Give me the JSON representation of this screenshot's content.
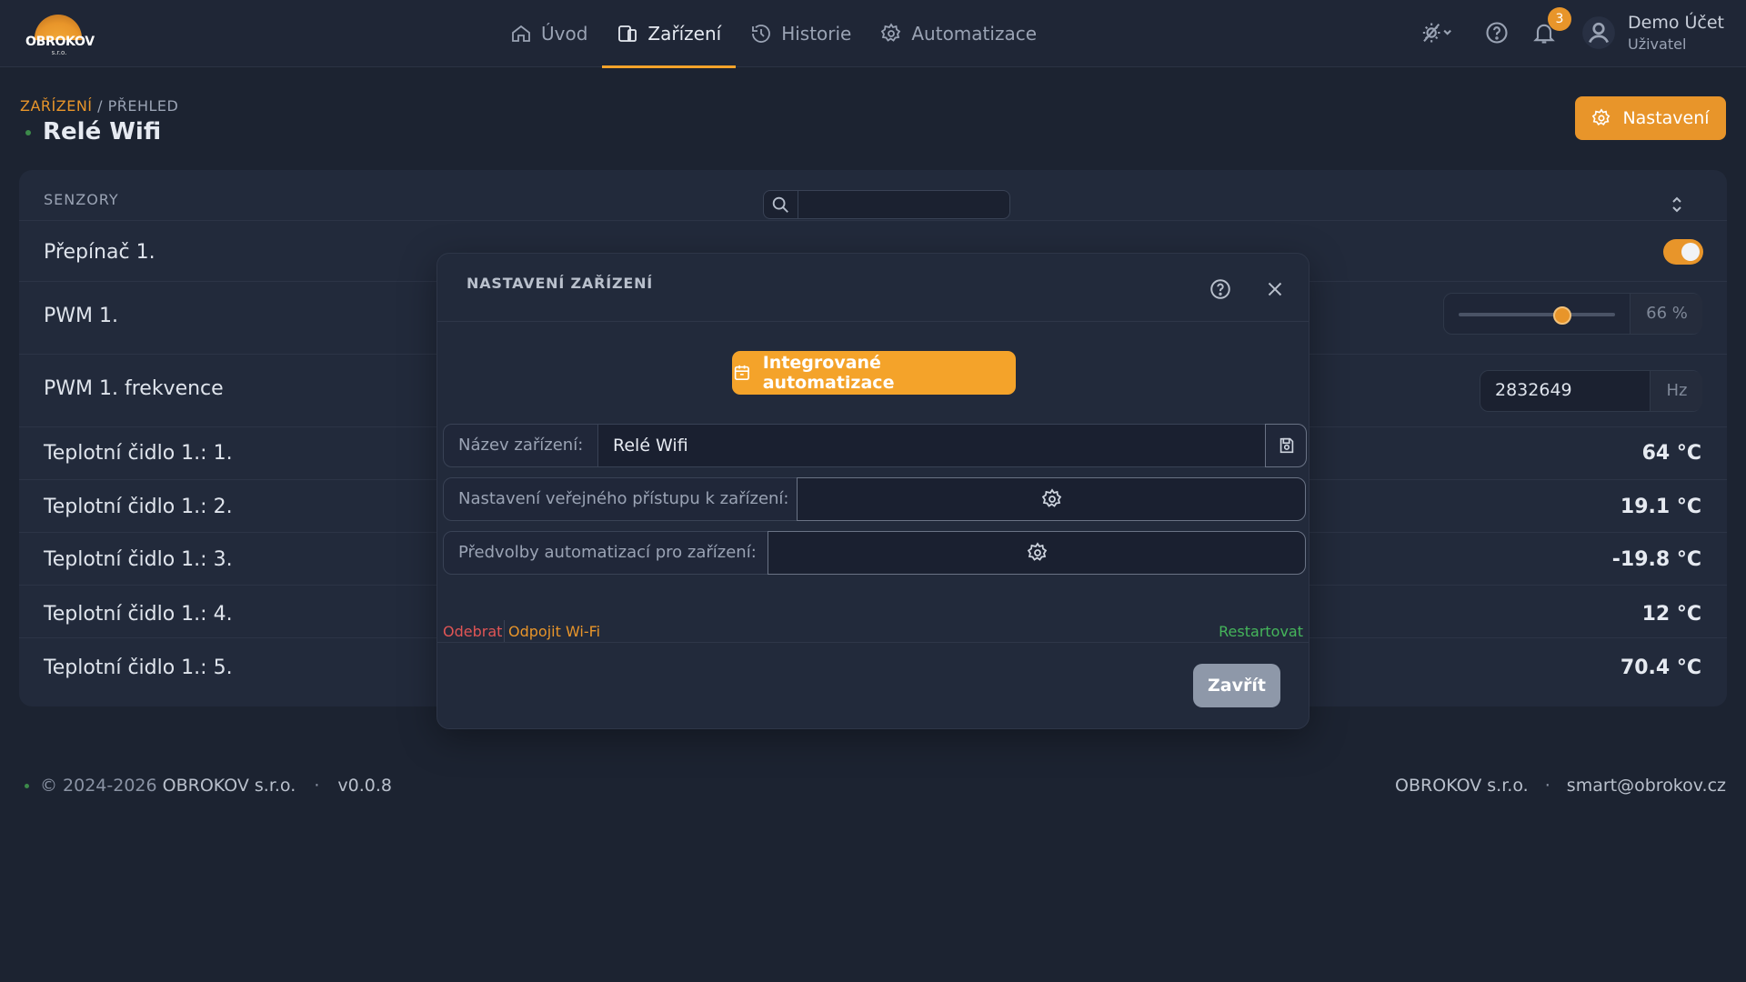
{
  "app": {
    "logo_text": "OBROKOV",
    "logo_sub": "s.r.o."
  },
  "nav": {
    "items": [
      {
        "label": "Úvod",
        "icon": "home-icon"
      },
      {
        "label": "Zařízení",
        "icon": "devices-icon",
        "active": true
      },
      {
        "label": "Historie",
        "icon": "history-icon"
      },
      {
        "label": "Automatizace",
        "icon": "gear-icon"
      }
    ]
  },
  "user": {
    "notifications": "3",
    "name": "Demo Účet",
    "role": "Uživatel"
  },
  "header": {
    "breadcrumb_link": "ZAŘÍZENÍ",
    "breadcrumb_sep": " / ",
    "breadcrumb_current": "PŘEHLED",
    "title": "Relé Wifi",
    "settings_label": "Nastavení"
  },
  "sensors": {
    "title": "SENZORY",
    "search_placeholder": "",
    "switch": {
      "label": "Přepínač 1.",
      "on": true
    },
    "pwm": {
      "label": "PWM 1.",
      "value": 66,
      "display": "66 %"
    },
    "freq": {
      "label": "PWM 1. frekvence",
      "value": "2832649",
      "unit": "Hz"
    },
    "temps": [
      {
        "label": "Teplotní čidlo 1.: 1.",
        "value": "64 °C"
      },
      {
        "label": "Teplotní čidlo 1.: 2.",
        "value": "19.1 °C"
      },
      {
        "label": "Teplotní čidlo 1.: 3.",
        "value": "-19.8 °C"
      },
      {
        "label": "Teplotní čidlo 1.: 4.",
        "value": "12 °C"
      },
      {
        "label": "Teplotní čidlo 1.: 5.",
        "value": "70.4 °C"
      }
    ]
  },
  "modal": {
    "title": "NASTAVENÍ ZAŘÍZENÍ",
    "automations_button": "Integrované automatizace",
    "name_label": "Název zařízení:",
    "name_value": "Relé Wifi",
    "public_access_label": "Nastavení veřejného přístupu k zařízení:",
    "presets_label": "Předvolby automatizací pro zařízení:",
    "remove": "Odebrat",
    "disconnect_wifi": "Odpojit Wi-Fi",
    "restart": "Restartovat",
    "close": "Zavřít"
  },
  "footer": {
    "copyright": "© 2024-2026 ",
    "company": "OBROKOV s.r.o.",
    "sep": "·",
    "version": "v0.0.8",
    "company_right": "OBROKOV s.r.o.",
    "email": "smart@obrokov.cz"
  },
  "colors": {
    "accent": "#e8952a",
    "background": "#1c2331",
    "card": "#222a3b",
    "danger": "#e05555",
    "success": "#45b55b"
  }
}
